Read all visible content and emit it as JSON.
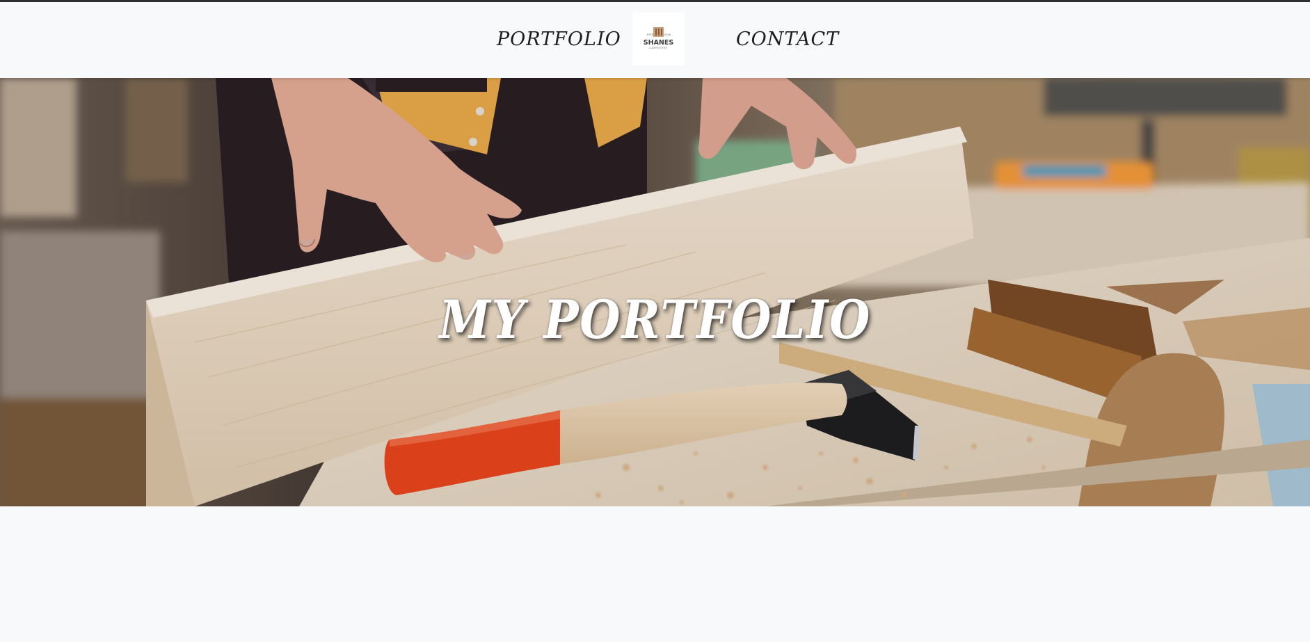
{
  "nav": {
    "portfolio_label": "PORTFOLIO",
    "contact_label": "CONTACT",
    "logo": {
      "estd_left": "ESTD",
      "estd_right": "2016",
      "name": "SHANES",
      "tagline": "CARPENTRY"
    }
  },
  "hero": {
    "title": "MY PORTFOLIO"
  },
  "colors": {
    "nav_background": "#f8f9fa",
    "nav_text": "#1d1d1f",
    "hero_title": "#ffffff",
    "hammer_handle_red": "#e8441c",
    "page_background": "#f8f9fb"
  }
}
